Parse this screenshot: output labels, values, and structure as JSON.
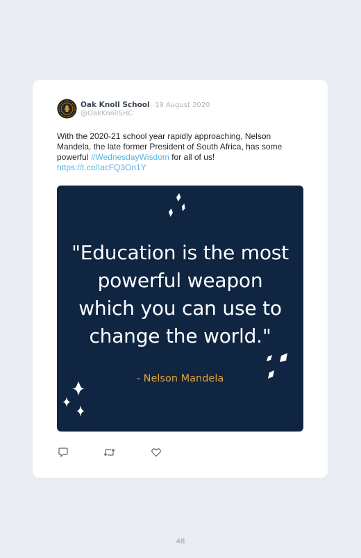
{
  "tweet": {
    "author_name": "Oak Knoll School",
    "separator": "·",
    "date": "19 August 2020",
    "handle": "@OakKnollSHC",
    "text_before": "With the 2020-21 school year rapidly approaching, Nelson Mandela, the late former President of South Africa, has some powerful ",
    "hashtag": "#WednesdayWisdom",
    "text_after": " for all of us!",
    "link": "https://t.co/IacFQ3On1Y"
  },
  "media": {
    "quote": "\"Education is the most\npowerful weapon\nwhich you can use to\nchange the world.\"",
    "attribution": "- Nelson Mandela",
    "background_color": "#0f2541",
    "attribution_color": "#e0a43a"
  },
  "actions": {
    "reply_icon": "reply-icon",
    "retweet_icon": "retweet-icon",
    "like_icon": "heart-icon"
  },
  "page": {
    "number": "48"
  },
  "colors": {
    "page_background": "#e9ecf0",
    "link": "#5ab3e3",
    "muted": "#aab4bd"
  }
}
